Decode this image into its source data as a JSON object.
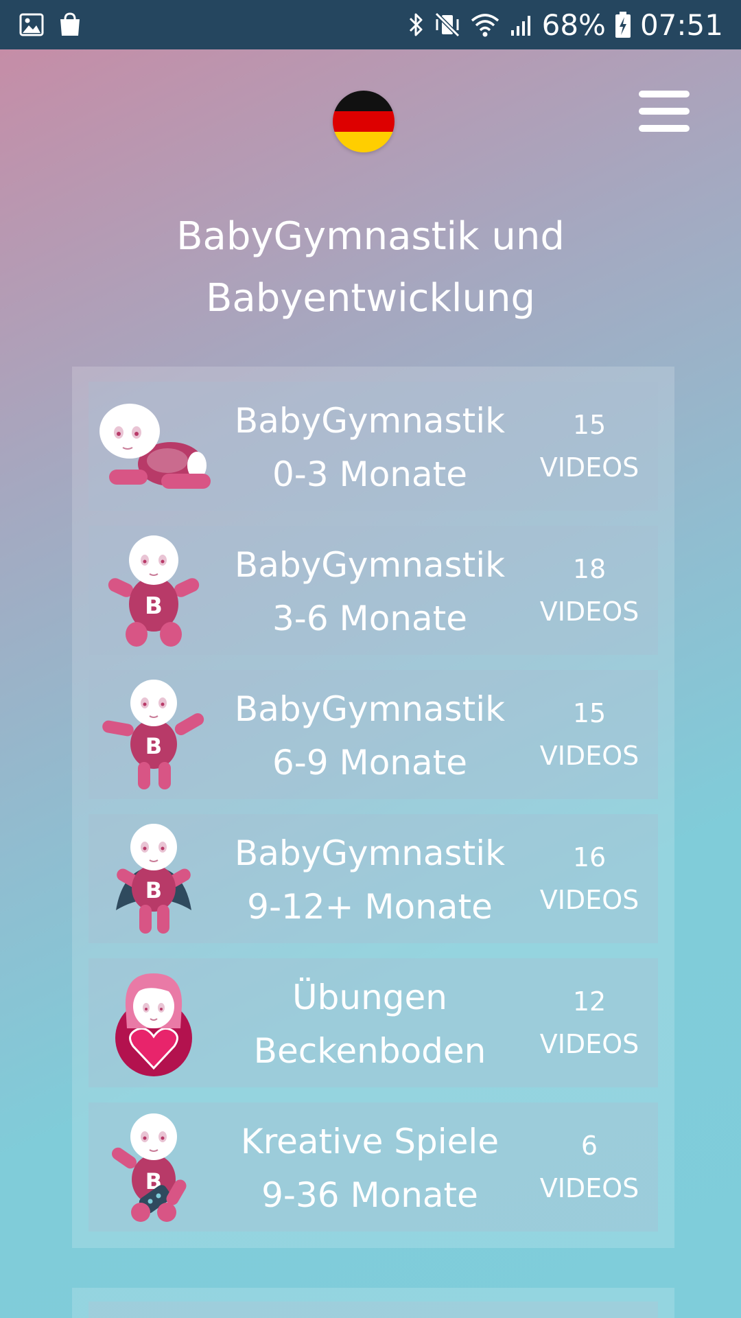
{
  "status_bar": {
    "battery": "68%",
    "time": "07:51",
    "left_icons": [
      "gallery-icon",
      "shopping-bag-icon"
    ],
    "right_icons": [
      "bluetooth-icon",
      "vibrate-mute-icon",
      "wifi-icon",
      "signal-icon",
      "battery-charging-icon"
    ]
  },
  "header": {
    "language_flag": "germany-flag-icon",
    "menu_icon": "hamburger-menu-icon",
    "title_line1": "BabyGymnastik und",
    "title_line2": "Babyentwicklung"
  },
  "colors": {
    "status_bar": "#25465f",
    "accent_pink": "#c8416f",
    "text": "#ffffff"
  },
  "courses": [
    {
      "title_line1": "BabyGymnastik",
      "title_line2": "0-3 Monate",
      "count": "15",
      "unit": "VIDEOS",
      "icon": "crawling-baby-icon"
    },
    {
      "title_line1": "BabyGymnastik",
      "title_line2": "3-6 Monate",
      "count": "18",
      "unit": "VIDEOS",
      "icon": "sitting-baby-icon"
    },
    {
      "title_line1": "BabyGymnastik",
      "title_line2": "6-9 Monate",
      "count": "15",
      "unit": "VIDEOS",
      "icon": "standing-baby-icon"
    },
    {
      "title_line1": "BabyGymnastik",
      "title_line2": "9-12+ Monate",
      "count": "16",
      "unit": "VIDEOS",
      "icon": "caped-baby-icon"
    },
    {
      "title_line1": "Übungen",
      "title_line2": "Beckenboden",
      "count": "12",
      "unit": "VIDEOS",
      "icon": "mother-heart-icon"
    },
    {
      "title_line1": "Kreative Spiele",
      "title_line2": "9-36 Monate",
      "count": "6",
      "unit": "VIDEOS",
      "icon": "baby-with-toy-icon"
    }
  ]
}
